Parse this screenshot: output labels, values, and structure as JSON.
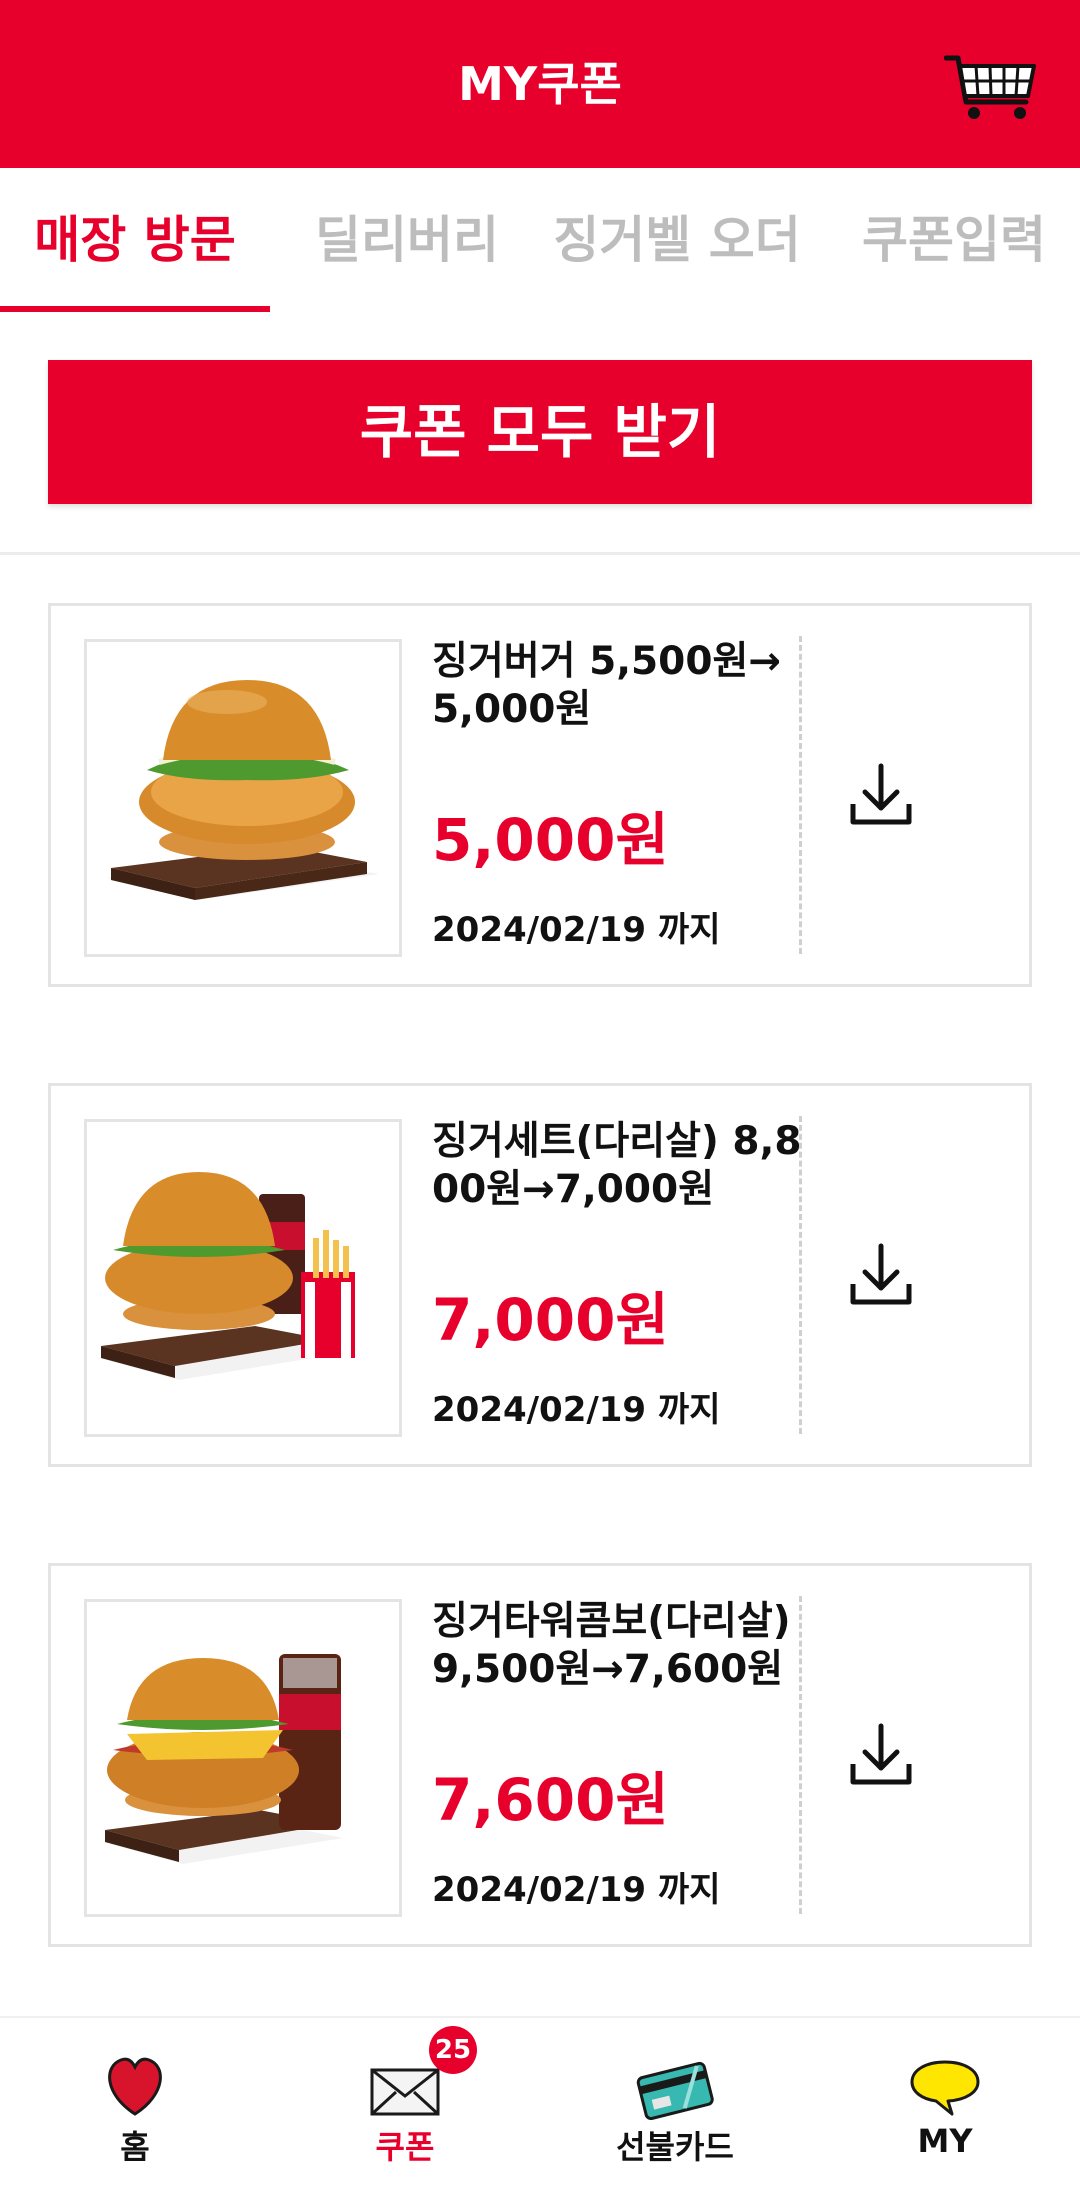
{
  "header": {
    "title": "MY쿠폰",
    "cart_icon": "cart-icon"
  },
  "tabs": [
    {
      "label": "매장 방문",
      "active": true
    },
    {
      "label": "딜리버리",
      "active": false
    },
    {
      "label": "징거벨 오더",
      "active": false
    },
    {
      "label": "쿠폰입력",
      "active": false
    }
  ],
  "receive_all": {
    "label": "쿠폰 모두 받기"
  },
  "coupons": [
    {
      "name": "징거버거 5,500원→5,000원",
      "price": "5,000원",
      "expiry": "2024/02/19 까지",
      "image": "zinger-burger-image",
      "action_icon": "download-icon"
    },
    {
      "name": "징거세트(다리살) 8,800원→7,000원",
      "price": "7,000원",
      "expiry": "2024/02/19 까지",
      "image": "zinger-set-image",
      "action_icon": "download-icon"
    },
    {
      "name": "징거타워콤보(다리살) 9,500원→7,600원",
      "price": "7,600원",
      "expiry": "2024/02/19 까지",
      "image": "zinger-tower-combo-image",
      "action_icon": "download-icon"
    }
  ],
  "bottom_nav": [
    {
      "label": "홈",
      "icon": "heart-icon",
      "active": false
    },
    {
      "label": "쿠폰",
      "icon": "envelope-icon",
      "active": true,
      "badge": "25"
    },
    {
      "label": "선불카드",
      "icon": "prepaid-card-icon",
      "active": false
    },
    {
      "label": "MY",
      "icon": "speech-bubble-icon",
      "active": false
    }
  ],
  "colors": {
    "brand_red": "#e8002c",
    "inactive_tab": "#bdbdbd",
    "border": "#e4e4e4"
  }
}
